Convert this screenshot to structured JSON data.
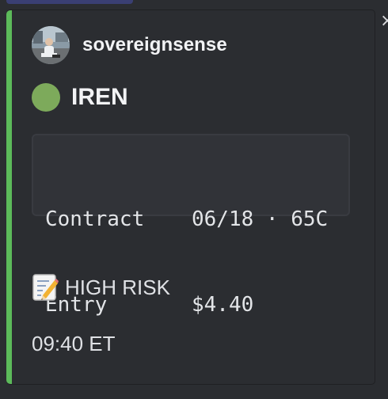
{
  "colors": {
    "accent": "#5cba5a",
    "status_dot": "#7daa5b"
  },
  "post": {
    "author": "sovereignsense",
    "title": "IREN",
    "status_icon": "green-circle-icon",
    "details": [
      {
        "label": "Contract",
        "value": "06/18 · 65C"
      },
      {
        "label": "Entry",
        "value": "$4.40"
      }
    ],
    "note_icon": "memo-icon",
    "note": "HIGH RISK",
    "time": "09:40 ET"
  },
  "window": {
    "close_icon": "close-icon"
  }
}
